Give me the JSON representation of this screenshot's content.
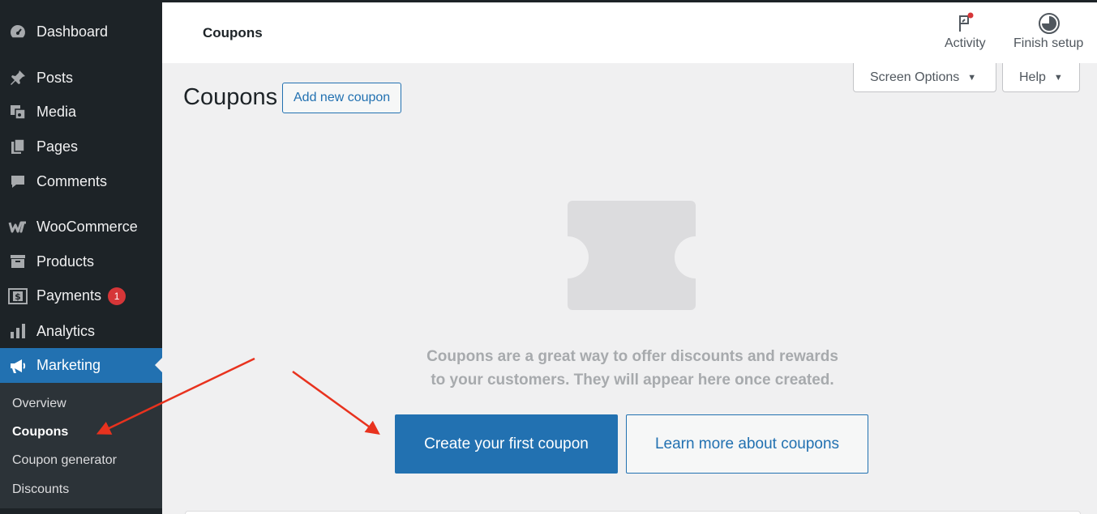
{
  "sidebar": {
    "items": [
      {
        "label": "Dashboard",
        "icon": "dashboard-icon"
      },
      {
        "label": "Posts",
        "icon": "pin-icon"
      },
      {
        "label": "Media",
        "icon": "media-icon"
      },
      {
        "label": "Pages",
        "icon": "pages-icon"
      },
      {
        "label": "Comments",
        "icon": "comment-icon"
      },
      {
        "label": "WooCommerce",
        "icon": "woocommerce-icon"
      },
      {
        "label": "Products",
        "icon": "archive-icon"
      },
      {
        "label": "Payments",
        "icon": "payments-icon",
        "badge": "1"
      },
      {
        "label": "Analytics",
        "icon": "bar-chart-icon"
      },
      {
        "label": "Marketing",
        "icon": "megaphone-icon",
        "active": true
      }
    ],
    "submenu": [
      {
        "label": "Overview"
      },
      {
        "label": "Coupons",
        "current": true
      },
      {
        "label": "Coupon generator"
      },
      {
        "label": "Discounts"
      }
    ]
  },
  "header": {
    "title": "Coupons",
    "activity_label": "Activity",
    "finish_setup_label": "Finish setup"
  },
  "screen_options": {
    "label": "Screen Options"
  },
  "help": {
    "label": "Help"
  },
  "page": {
    "heading": "Coupons",
    "add_new_label": "Add new coupon"
  },
  "empty_state": {
    "line1": "Coupons are a great way to offer discounts and rewards",
    "line2": "to your customers. They will appear here once created.",
    "create_label": "Create your first coupon",
    "learn_label": "Learn more about coupons"
  },
  "colors": {
    "sidebar_bg": "#1d2327",
    "accent": "#2271b1",
    "badge": "#d63638",
    "annotation_arrow": "#e8321e"
  }
}
